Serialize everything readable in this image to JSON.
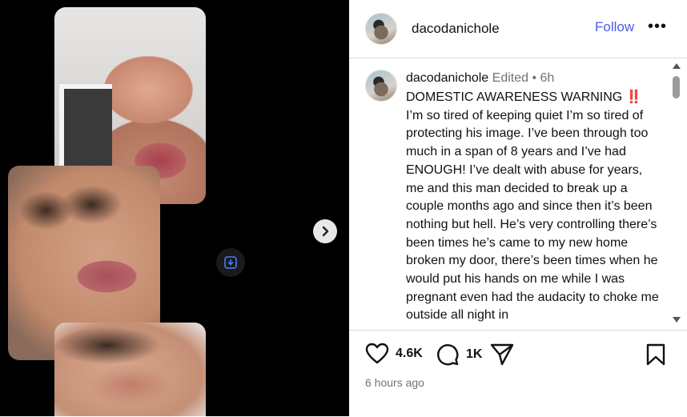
{
  "post": {
    "username": "dacodanichole",
    "follow_label": "Follow",
    "more_label": "•••",
    "caption": {
      "username": "dacodanichole",
      "meta": "Edited • 6h",
      "title": "DOMESTIC AWARENESS WARNING ‼️",
      "body": "I’m so tired of keeping quiet I’m so tired of protecting his image. I’ve been through too much in a span of 8 years and I’ve had ENOUGH! I’ve dealt with abuse for years, me and this man decided to break up a couple months ago and since then it’s been nothing but hell. He’s very controlling there’s been times he’s came to my new home broken my door, there’s been times when he would put his hands on me while I was pregnant even had the audacity to choke me outside all night in"
    },
    "likes": "4.6K",
    "comments": "1K",
    "time_ago": "6 hours ago"
  },
  "icons": {
    "next": "chevron-right-icon",
    "save_media": "download-icon",
    "like": "heart-icon",
    "comment": "comment-icon",
    "share": "share-icon",
    "bookmark": "bookmark-icon"
  }
}
